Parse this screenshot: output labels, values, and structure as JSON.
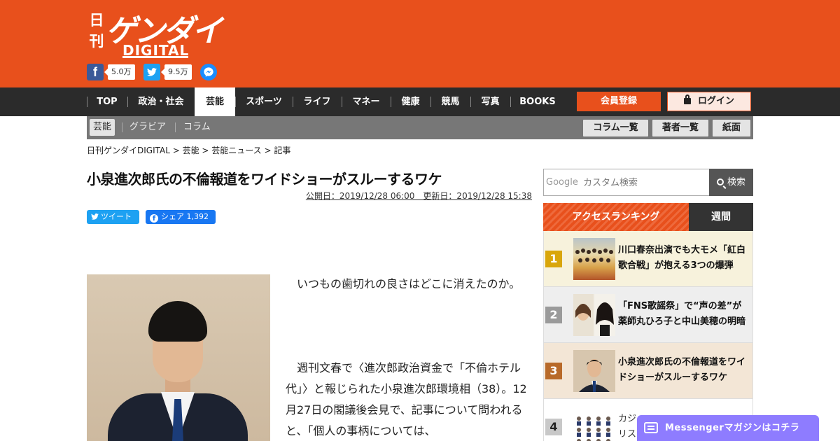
{
  "header": {
    "logo_nikkan": "日刊",
    "logo_main": "ゲンダイ",
    "logo_sub": "DIGITAL",
    "facebook_count": "5.0万",
    "twitter_count": "9.5万"
  },
  "nav": {
    "items": [
      "TOP",
      "政治・社会",
      "芸能",
      "スポーツ",
      "ライフ",
      "マネー",
      "健康",
      "競馬",
      "写真",
      "BOOKS"
    ],
    "active": "芸能",
    "register": "会員登録",
    "login": "ログイン"
  },
  "subnav": {
    "items": [
      "芸能",
      "グラビア",
      "コラム"
    ],
    "buttons": [
      "コラム一覧",
      "著者一覧",
      "紙面"
    ]
  },
  "breadcrumb": "日刊ゲンダイDIGITAL > 芸能 > 芸能ニュース > 記事",
  "article": {
    "title": "小泉進次郎氏の不倫報道をワイドショーがスルーするワケ",
    "dates": "公開日：2019/12/28 06:00　更新日：2019/12/28 15:38",
    "tweet_label": "ツイート",
    "share_label": "シェア 1,392",
    "paragraphs": [
      "　いつもの歯切れの良さはどこに消えたのか。",
      "　週刊文春で〈進次郎政治資金で「不倫ホテル代」〉と報じられた小泉進次郎環境相（38）。12月27日の閣議後会見で、記事について問われると、「個人の事柄については、"
    ]
  },
  "sidebar": {
    "search_logo": "Google",
    "search_placeholder": "カスタム検索",
    "search_button": "検索",
    "ranking_title": "アクセスランキング",
    "ranking_tab": "週間",
    "ranking": [
      {
        "rank": "1",
        "text": "川口春奈出演でも大モメ「紅白歌合戦」が抱える3つの爆弾"
      },
      {
        "rank": "2",
        "text": "「FNS歌謡祭」で“声の差”が 薬師丸ひろ子と中山美穂の明暗"
      },
      {
        "rank": "3",
        "text": "小泉進次郎氏の不倫報道をワイドショーがスルーするワケ"
      },
      {
        "rank": "4",
        "text": "カジ\nリス"
      }
    ]
  },
  "messenger": {
    "label": "Messengerマガジンはコチラ"
  },
  "colors": {
    "brand": "#e8501c",
    "nav_bg": "#2b2b2b",
    "rank1": "#d9a60b",
    "rank2": "#9a9a9a",
    "rank3": "#b86a2a",
    "rank4": "#c8c8c8",
    "messenger": "#8e7cff"
  }
}
